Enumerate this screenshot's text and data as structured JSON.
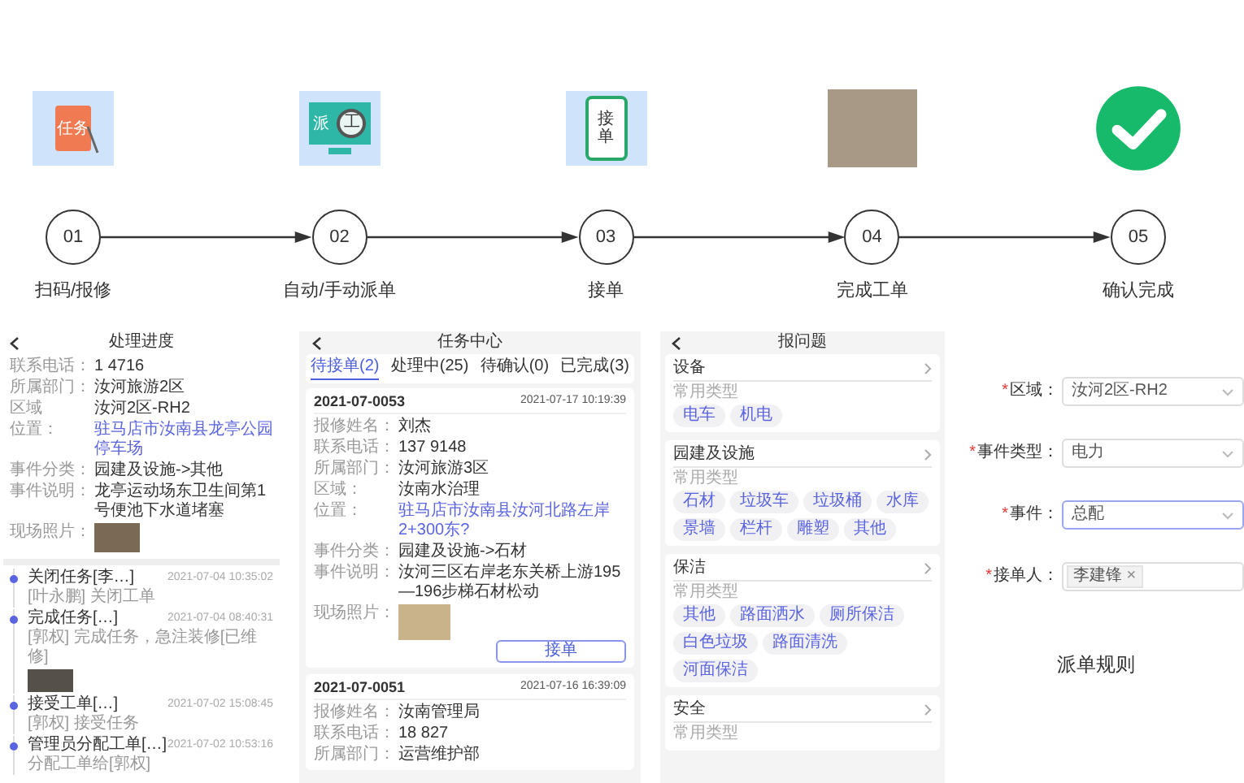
{
  "steps": [
    {
      "number": "01",
      "label": "扫码/报修",
      "kind": "task",
      "icon_texts": [
        "任务"
      ]
    },
    {
      "number": "02",
      "label": "自动/手动派单",
      "kind": "monitor",
      "icon_texts": [
        "派",
        "工"
      ]
    },
    {
      "number": "03",
      "label": "接单",
      "kind": "phone",
      "icon_texts": [
        "接单"
      ]
    },
    {
      "number": "04",
      "label": "完成工单",
      "kind": "photo"
    },
    {
      "number": "05",
      "label": "确认完成",
      "kind": "check"
    }
  ],
  "progress": {
    "title": "处理进度",
    "fields": [
      {
        "label": "联系电话：",
        "value": "1 4716",
        "kind": "text"
      },
      {
        "label": "所属部门：",
        "value": "汝河旅游2区",
        "kind": "text"
      },
      {
        "label": "区域",
        "value": "汝河2区-RH2",
        "kind": "text"
      },
      {
        "label": "位置：",
        "value": "驻马店市汝南县龙亭公园停车场",
        "kind": "link"
      },
      {
        "label": "事件分类：",
        "value": "园建及设施->其他",
        "kind": "text"
      },
      {
        "label": "事件说明：",
        "value": "龙亭运动场东卫生间第1号便池下水道堵塞",
        "kind": "text"
      },
      {
        "label": "现场照片：",
        "kind": "photo"
      }
    ],
    "timeline": [
      {
        "title": "关闭任务[李…]",
        "time": "2021-07-04 10:35:02",
        "note": "[叶永鹏] 关闭工单",
        "has_photo": false
      },
      {
        "title": "完成任务[…]",
        "time": "2021-07-04 08:40:31",
        "note": "[郭权] 完成任务，急注装修[已维修]",
        "has_photo": true
      },
      {
        "title": "接受工单[…]",
        "time": "2021-07-02 15:08:45",
        "note": "[郭权] 接受任务",
        "has_photo": false
      },
      {
        "title": "管理员分配工单[…]",
        "time": "2021-07-02 10:53:16",
        "note": "分配工单给[郭权]",
        "has_photo": false
      }
    ]
  },
  "task_center": {
    "title": "任务中心",
    "tabs": [
      {
        "label": "待接单(2)",
        "selected": true
      },
      {
        "label": "处理中(25)",
        "selected": false
      },
      {
        "label": "待确认(0)",
        "selected": false
      },
      {
        "label": "已完成(3)",
        "selected": false
      }
    ],
    "cards": [
      {
        "code": "2021-07-0053",
        "time": "2021-07-17 10:19:39",
        "button": "接单",
        "fields": [
          {
            "label": "报修姓名：",
            "value": "刘杰",
            "kind": "text"
          },
          {
            "label": "联系电话：",
            "value": "137 9148",
            "kind": "text"
          },
          {
            "label": "所属部门：",
            "value": "汝河旅游3区",
            "kind": "text"
          },
          {
            "label": "区域：",
            "value": "汝南水治理",
            "kind": "text"
          },
          {
            "label": "位置：",
            "value": "驻马店市汝南县汝河北路左岸2+300东?",
            "kind": "link"
          },
          {
            "label": "事件分类：",
            "value": "园建及设施->石材",
            "kind": "text"
          },
          {
            "label": "事件说明：",
            "value": "汝河三区右岸老东关桥上游195—196步梯石材松动",
            "kind": "text"
          },
          {
            "label": "现场照片：",
            "kind": "photo"
          }
        ]
      },
      {
        "code": "2021-07-0051",
        "time": "2021-07-16 16:39:09",
        "fields": [
          {
            "label": "报修姓名：",
            "value": "汝南管理局",
            "kind": "text"
          },
          {
            "label": "联系电话：",
            "value": "18 827",
            "kind": "text"
          },
          {
            "label": "所属部门：",
            "value": "运营维护部",
            "kind": "text"
          }
        ]
      }
    ]
  },
  "report": {
    "title": "报问题",
    "sections": [
      {
        "name": "设备",
        "subtitle": "常用类型",
        "tags": [
          "电车",
          "机电"
        ]
      },
      {
        "name": "园建及设施",
        "subtitle": "常用类型",
        "tags": [
          "石材",
          "垃圾车",
          "垃圾桶",
          "水库",
          "景墙",
          "栏杆",
          "雕塑",
          "其他"
        ]
      },
      {
        "name": "保洁",
        "subtitle": "常用类型",
        "tags": [
          "其他",
          "路面洒水",
          "厕所保洁",
          "白色垃圾",
          "路面清洗",
          "河面保洁"
        ]
      },
      {
        "name": "安全",
        "subtitle": "常用类型"
      }
    ]
  },
  "dispatch_rule": {
    "fields": [
      {
        "mark": "*",
        "label": "区域：",
        "kind": "select",
        "value": "汝河2区-RH2",
        "focused": false
      },
      {
        "mark": "*",
        "label": "事件类型：",
        "kind": "select",
        "value": "电力",
        "focused": false
      },
      {
        "mark": "*",
        "label": "事件：",
        "kind": "select",
        "value": "总配",
        "focused": true
      },
      {
        "mark": "*",
        "label": "接单人：",
        "kind": "tags",
        "tags": [
          {
            "name": "李建锋",
            "remove": "×"
          }
        ]
      }
    ],
    "caption": "派单规则"
  }
}
